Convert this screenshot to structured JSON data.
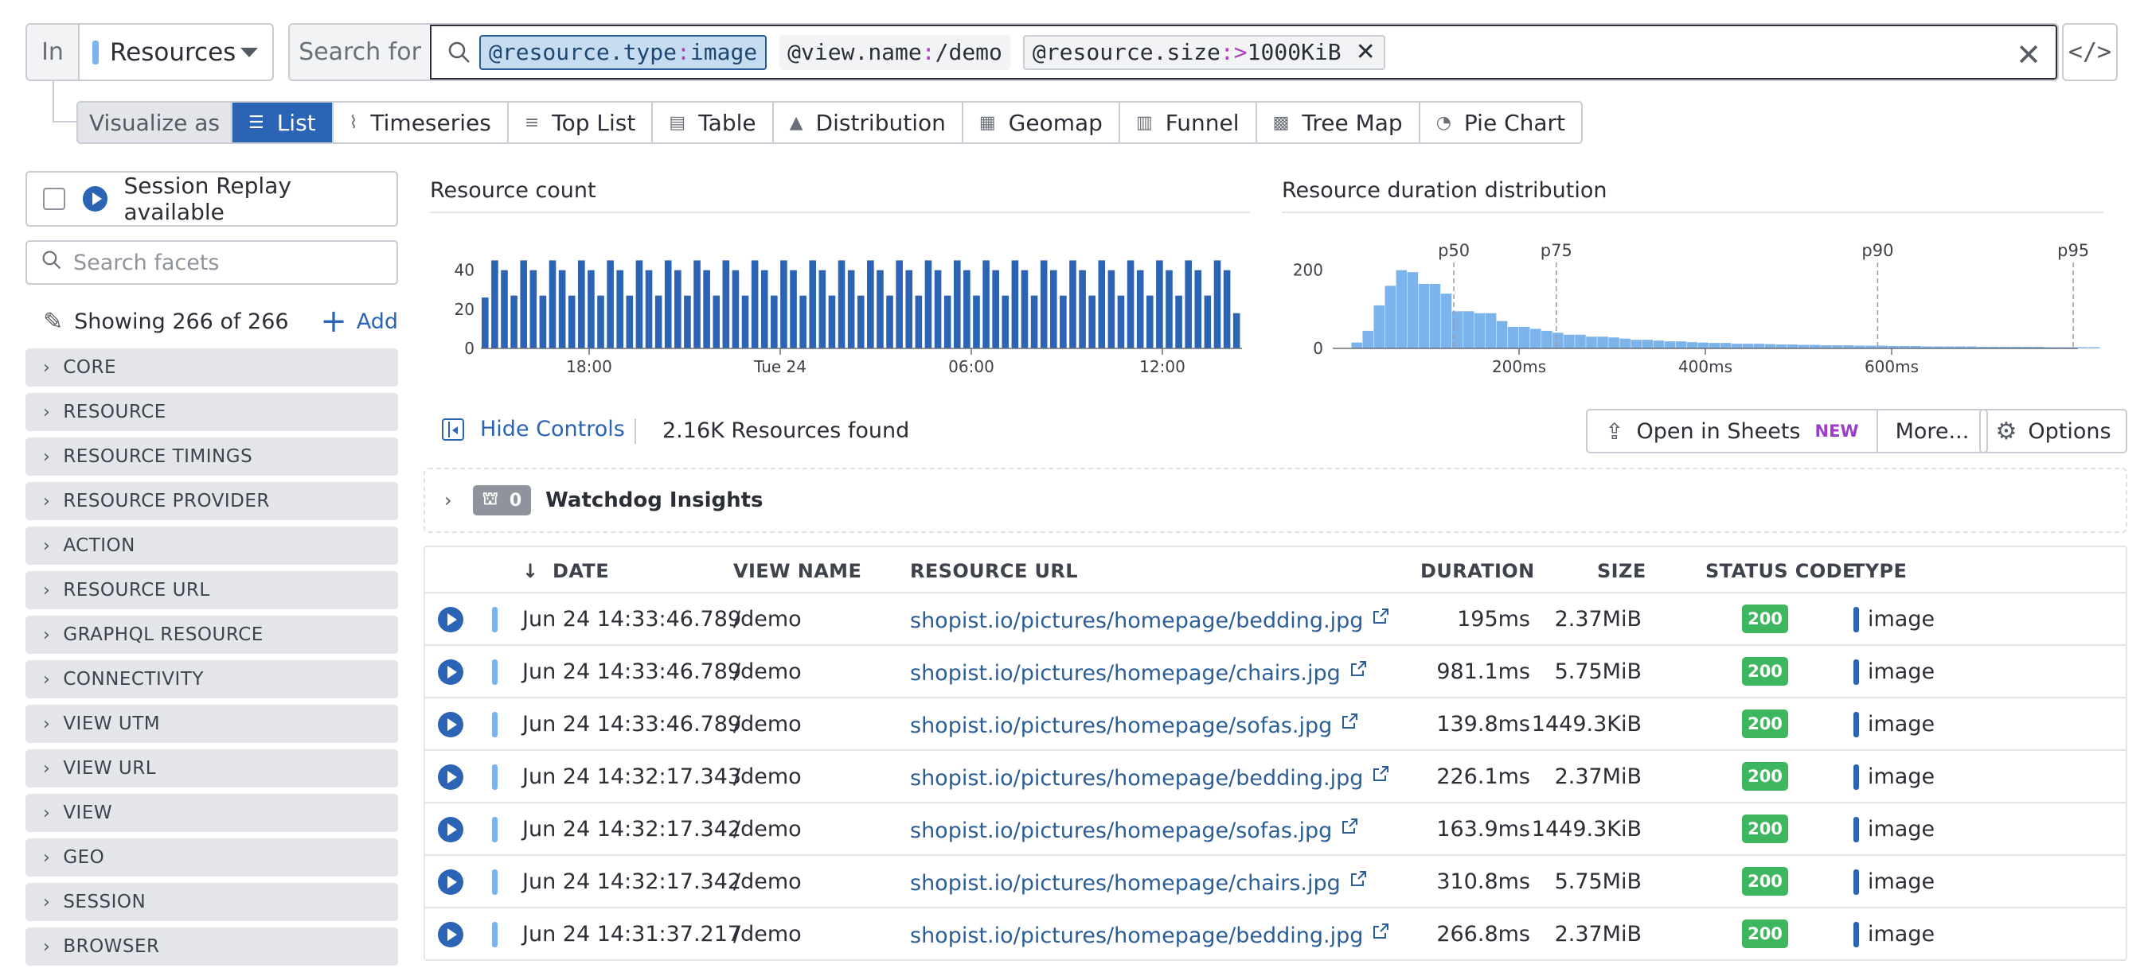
{
  "query": {
    "in_label": "In",
    "source": "Resources",
    "search_label": "Search for",
    "chips": [
      {
        "attr": "@resource.type",
        "sep": ":",
        "value": "image"
      },
      {
        "attr": "@view.name",
        "sep": ":",
        "value": "/demo"
      },
      {
        "attr": "@resource.size",
        "sep": ":",
        "op": ">",
        "value": "1000KiB"
      }
    ]
  },
  "visualize": {
    "label": "Visualize as",
    "options": [
      "List",
      "Timeseries",
      "Top List",
      "Table",
      "Distribution",
      "Geomap",
      "Funnel",
      "Tree Map",
      "Pie Chart"
    ],
    "active": "List"
  },
  "sidebar": {
    "session_replay": "Session Replay available",
    "search_placeholder": "Search facets",
    "showing": "Showing 266 of 266",
    "add": "Add",
    "facets": [
      "CORE",
      "RESOURCE",
      "RESOURCE TIMINGS",
      "RESOURCE PROVIDER",
      "ACTION",
      "RESOURCE URL",
      "GRAPHQL RESOURCE",
      "CONNECTIVITY",
      "VIEW UTM",
      "VIEW URL",
      "VIEW",
      "GEO",
      "SESSION",
      "BROWSER"
    ]
  },
  "chart_data": [
    {
      "type": "bar",
      "title": "Resource count",
      "xticks": [
        "18:00",
        "Tue 24",
        "06:00",
        "12:00"
      ],
      "ylim": [
        0,
        48
      ],
      "yticks": [
        0,
        20,
        40
      ],
      "values": [
        26,
        45,
        40,
        27,
        45,
        40,
        27,
        45,
        40,
        27,
        45,
        40,
        27,
        45,
        40,
        27,
        45,
        40,
        27,
        45,
        40,
        27,
        45,
        40,
        27,
        45,
        40,
        27,
        45,
        40,
        27,
        45,
        40,
        27,
        45,
        40,
        27,
        45,
        40,
        27,
        45,
        40,
        27,
        45,
        40,
        27,
        45,
        40,
        27,
        45,
        40,
        27,
        45,
        40,
        27,
        45,
        40,
        27,
        45,
        40,
        27,
        45,
        40,
        27,
        45,
        40,
        27,
        45,
        40,
        27,
        45,
        40,
        27,
        45,
        40,
        27,
        45,
        40,
        18
      ],
      "color": "#2b63b5"
    },
    {
      "type": "bar",
      "title": "Resource duration distribution",
      "xticks": [
        "200ms",
        "400ms",
        "600ms"
      ],
      "xlim": [
        0,
        800
      ],
      "ylim": [
        0,
        240
      ],
      "yticks": [
        0,
        200
      ],
      "bin_width_ms": 12,
      "bin_start_ms": 20,
      "values": [
        15,
        45,
        110,
        160,
        200,
        195,
        165,
        165,
        140,
        95,
        95,
        90,
        90,
        70,
        55,
        55,
        50,
        45,
        40,
        35,
        35,
        30,
        30,
        28,
        25,
        22,
        22,
        20,
        18,
        18,
        16,
        15,
        14,
        14,
        12,
        12,
        12,
        11,
        10,
        10,
        9,
        9,
        8,
        8,
        8,
        7,
        7,
        7,
        6,
        6,
        6,
        5,
        5,
        5,
        5,
        5,
        4,
        4,
        4,
        4,
        4,
        4,
        3,
        3,
        3,
        3,
        3
      ],
      "percentiles": [
        {
          "label": "p50",
          "x_ms": 130
        },
        {
          "label": "p75",
          "x_ms": 240
        },
        {
          "label": "p90",
          "x_ms": 585
        },
        {
          "label": "p95",
          "x_ms": 795
        }
      ],
      "color": "#7cb3ea"
    }
  ],
  "controls": {
    "hide_controls": "Hide Controls",
    "found": "2.16K Resources found",
    "open_in_sheets": "Open in Sheets",
    "new_badge": "NEW",
    "more": "More...",
    "options": "Options"
  },
  "watchdog": {
    "count": "0",
    "title": "Watchdog Insights"
  },
  "table": {
    "columns": [
      "DATE",
      "VIEW NAME",
      "RESOURCE URL",
      "DURATION",
      "SIZE",
      "STATUS CODE",
      "TYPE"
    ],
    "rows": [
      {
        "date": "Jun 24 14:33:46.789",
        "view": "/demo",
        "url": "shopist.io/pictures/homepage/bedding.jpg",
        "duration": "195ms",
        "size": "2.37MiB",
        "status": "200",
        "type": "image"
      },
      {
        "date": "Jun 24 14:33:46.789",
        "view": "/demo",
        "url": "shopist.io/pictures/homepage/chairs.jpg",
        "duration": "981.1ms",
        "size": "5.75MiB",
        "status": "200",
        "type": "image"
      },
      {
        "date": "Jun 24 14:33:46.789",
        "view": "/demo",
        "url": "shopist.io/pictures/homepage/sofas.jpg",
        "duration": "139.8ms",
        "size": "1449.3KiB",
        "status": "200",
        "type": "image"
      },
      {
        "date": "Jun 24 14:32:17.343",
        "view": "/demo",
        "url": "shopist.io/pictures/homepage/bedding.jpg",
        "duration": "226.1ms",
        "size": "2.37MiB",
        "status": "200",
        "type": "image"
      },
      {
        "date": "Jun 24 14:32:17.342",
        "view": "/demo",
        "url": "shopist.io/pictures/homepage/sofas.jpg",
        "duration": "163.9ms",
        "size": "1449.3KiB",
        "status": "200",
        "type": "image"
      },
      {
        "date": "Jun 24 14:32:17.342",
        "view": "/demo",
        "url": "shopist.io/pictures/homepage/chairs.jpg",
        "duration": "310.8ms",
        "size": "5.75MiB",
        "status": "200",
        "type": "image"
      },
      {
        "date": "Jun 24 14:31:37.217",
        "view": "/demo",
        "url": "shopist.io/pictures/homepage/bedding.jpg",
        "duration": "266.8ms",
        "size": "2.37MiB",
        "status": "200",
        "type": "image"
      }
    ]
  }
}
